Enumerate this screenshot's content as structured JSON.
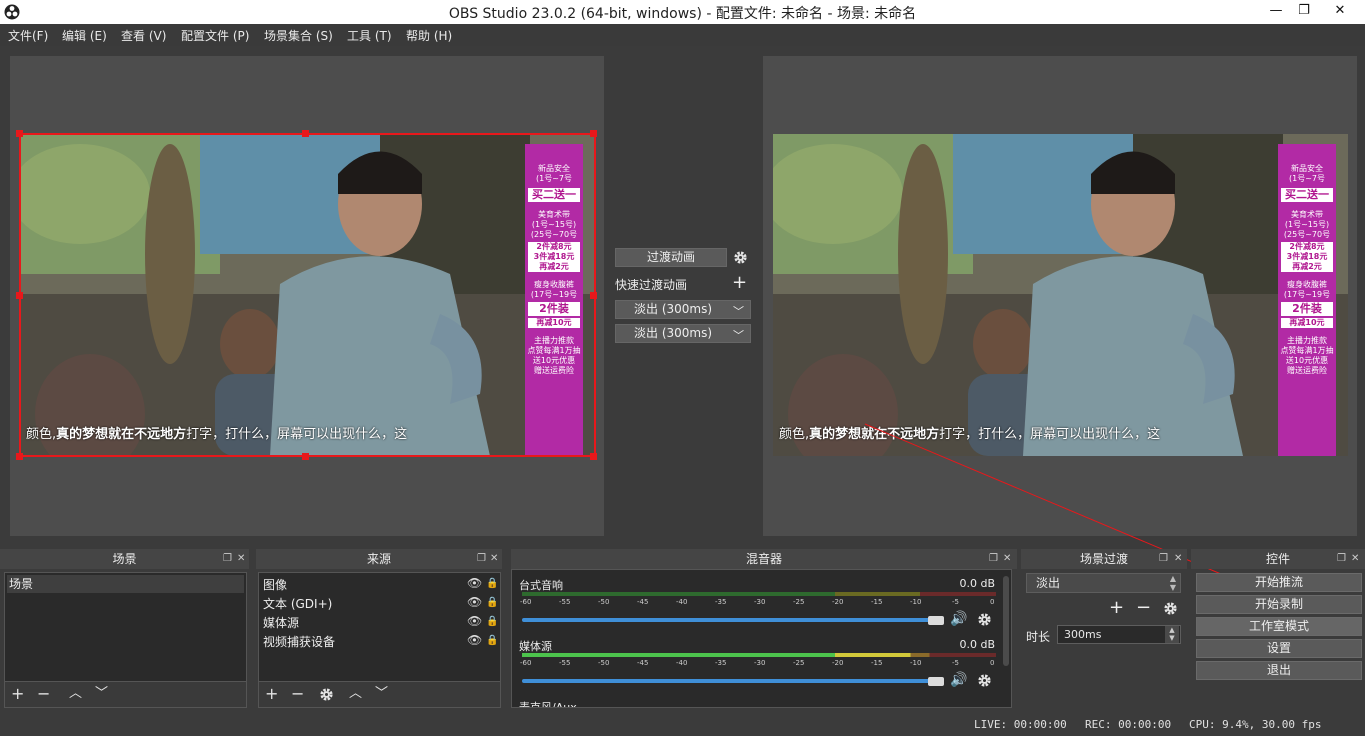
{
  "window": {
    "title": "OBS Studio 23.0.2 (64-bit, windows) - 配置文件: 未命名 - 场景: 未命名",
    "minimize": "—",
    "maximize": "❐",
    "close": "✕"
  },
  "menu": [
    "文件(F)",
    "编辑 (E)",
    "查看 (V)",
    "配置文件 (P)",
    "场景集合 (S)",
    "工具 (T)",
    "帮助 (H)"
  ],
  "preview": {
    "subtitle_a": "颜色,",
    "subtitle_b": "真的梦想就在不远地方",
    "subtitle_c": "打字，打什么，屏幕可以出现什么，这",
    "banner": {
      "title1": "新品安全",
      "line1": "(1号~7号",
      "big1": "买二送一",
      "title2": "美育术带",
      "line2": "(1号~15号)",
      "line3": "(25号~70号",
      "deal1": "2件减8元",
      "deal2": "3件减18元",
      "deal3": "再减2元",
      "title3": "瘦身收腹裤",
      "line4": "(17号~19号",
      "big2": "2件装",
      "deal4": "再减10元",
      "title4": "主播力推款",
      "line5": "点赞每满1万抽",
      "line6": "送10元优惠",
      "line7": "赠送运费险"
    }
  },
  "transition": {
    "button": "过渡动画",
    "quick": "快速过渡动画",
    "option1": "淡出 (300ms)",
    "option2": "淡出 (300ms)"
  },
  "docks": {
    "scenes": {
      "title": "场景",
      "items": [
        "场景"
      ]
    },
    "sources": {
      "title": "来源",
      "items": [
        "图像",
        "文本 (GDI+)",
        "媒体源",
        "视频捕获设备"
      ]
    },
    "mixer": {
      "title": "混音器",
      "channels": [
        {
          "name": "台式音响",
          "db": "0.0 dB"
        },
        {
          "name": "媒体源",
          "db": "0.0 dB"
        },
        {
          "name": "麦克风/Aux"
        }
      ],
      "ticks": [
        "-60",
        "-55",
        "-50",
        "-45",
        "-40",
        "-35",
        "-30",
        "-25",
        "-20",
        "-15",
        "-10",
        "-5",
        "0"
      ]
    },
    "scene_transitions": {
      "title": "场景过渡",
      "selected": "淡出",
      "duration_label": "时长",
      "duration": "300ms"
    },
    "controls": {
      "title": "控件",
      "buttons": [
        "开始推流",
        "开始录制",
        "工作室模式",
        "设置",
        "退出"
      ]
    }
  },
  "status": {
    "live": "LIVE: 00:00:00",
    "rec": "REC: 00:00:00",
    "cpu": "CPU: 9.4%, 30.00 fps"
  },
  "colors": {
    "selection": "#e8181b",
    "volume": "#3f8fd8",
    "meter_green": "#4cc34c",
    "meter_yellow": "#d2c93a",
    "meter_red": "#d0403a"
  }
}
